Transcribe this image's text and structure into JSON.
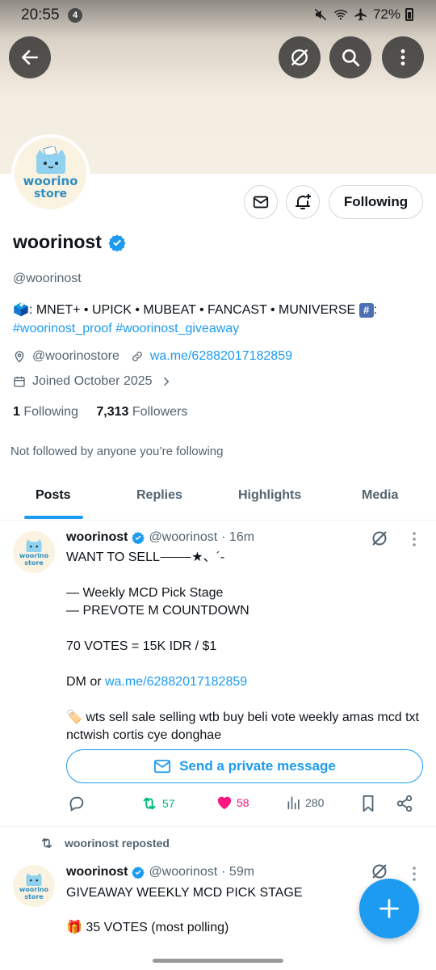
{
  "status_bar": {
    "time": "20:55",
    "notification_count": "4",
    "battery": "72%"
  },
  "profile": {
    "logo_line1": "woorino",
    "logo_line2": "store",
    "name": "woorinost",
    "handle": "@woorinost",
    "bio_prefix": ": MNET+ • UPICK • MUBEAT • FANCAST • MUNIVERSE",
    "bio_suffix": ":",
    "bio_hashtags": "#woorinost_proof #woorinost_giveaway",
    "location": "@woorinostore",
    "website": "wa.me/62882017182859",
    "joined": "Joined October 2025",
    "following_count": "1",
    "following_label": "Following",
    "followers_count": "7,313",
    "followers_label": "Followers",
    "not_followed": "Not followed by anyone you’re following",
    "follow_button": "Following"
  },
  "tabs": [
    "Posts",
    "Replies",
    "Highlights",
    "Media"
  ],
  "post1": {
    "name": "woorinost",
    "handle": "@woorinost",
    "time": "· 16m",
    "line1": "WANT TO SELL⸻★、´-",
    "line2": "— Weekly MCD Pick Stage",
    "line3": "— PREVOTE M COUNTDOWN",
    "line4": "70 VOTES = 15K IDR / $1",
    "line5_prefix": "DM or ",
    "line5_link": "wa.me/62882017182859",
    "line6": "wts sell sale selling wtb buy beli vote weekly amas mcd txt nctwish cortis cye donghae",
    "dm_button": "Send a private message",
    "reposts": "57",
    "likes": "58",
    "views": "280"
  },
  "post2": {
    "repost_label": "woorinost reposted",
    "name": "woorinost",
    "handle": "@woorinost",
    "time": "· 59m",
    "line1": "GIVEAWAY WEEKLY MCD PICK STAGE",
    "line2": "35 VOTES (most polling)"
  },
  "colors": {
    "accent": "#1d9bf0",
    "repost_green": "#00ba7c",
    "like_pink": "#f91880"
  }
}
